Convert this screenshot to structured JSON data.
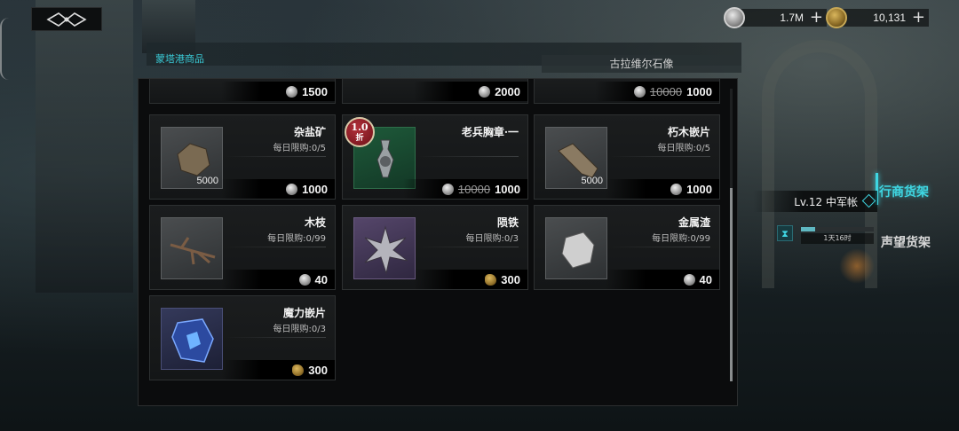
{
  "currencies": [
    {
      "icon": "silver-coin-icon",
      "value": "1.7M",
      "plus": "+"
    },
    {
      "icon": "gold-coin-icon",
      "value": "10,131",
      "plus": "+"
    }
  ],
  "shop": {
    "title": "蒙塔港商品",
    "merchant": "古拉维尔石像"
  },
  "top_row": [
    {
      "price": "1500",
      "coin": "silver"
    },
    {
      "price": "2000",
      "coin": "silver"
    },
    {
      "old_price": "10000",
      "price": "1000",
      "coin": "silver"
    }
  ],
  "items": [
    {
      "name": "杂盐矿",
      "limit": "每日限购:0/5",
      "qty": "5000",
      "price": "1000",
      "coin": "silver",
      "thumb": "gray",
      "icon": "salt-ore-icon"
    },
    {
      "name": "老兵胸章·一",
      "limit": "",
      "qty": "",
      "old_price": "10000",
      "price": "1000",
      "coin": "silver",
      "thumb": "green",
      "icon": "veteran-badge-icon",
      "discount": "1.0",
      "discount_unit": "折"
    },
    {
      "name": "朽木嵌片",
      "limit": "每日限购:0/5",
      "qty": "5000",
      "price": "1000",
      "coin": "silver",
      "thumb": "gray",
      "icon": "rotten-wood-icon"
    },
    {
      "name": "木枝",
      "limit": "每日限购:0/99",
      "qty": "",
      "price": "40",
      "coin": "silver",
      "thumb": "gray",
      "icon": "twig-icon"
    },
    {
      "name": "陨铁",
      "limit": "每日限购:0/3",
      "qty": "",
      "price": "300",
      "coin": "gold",
      "thumb": "purple",
      "icon": "meteor-iron-icon"
    },
    {
      "name": "金属渣",
      "limit": "每日限购:0/99",
      "qty": "",
      "price": "40",
      "coin": "silver",
      "thumb": "gray",
      "icon": "metal-slag-icon"
    },
    {
      "name": "魔力嵌片",
      "limit": "每日限购:0/3",
      "qty": "",
      "price": "300",
      "coin": "gold",
      "thumb": "blue",
      "icon": "magic-shard-icon"
    }
  ],
  "side": {
    "level": "Lv.12 中军帐",
    "tab_active": "行商货架",
    "tab_inactive": "声望货架",
    "timer": "1天16时",
    "timer_progress": 0.2
  },
  "colors": {
    "accent": "#3fd6e2",
    "panel_bg": "#0b0c0d"
  }
}
